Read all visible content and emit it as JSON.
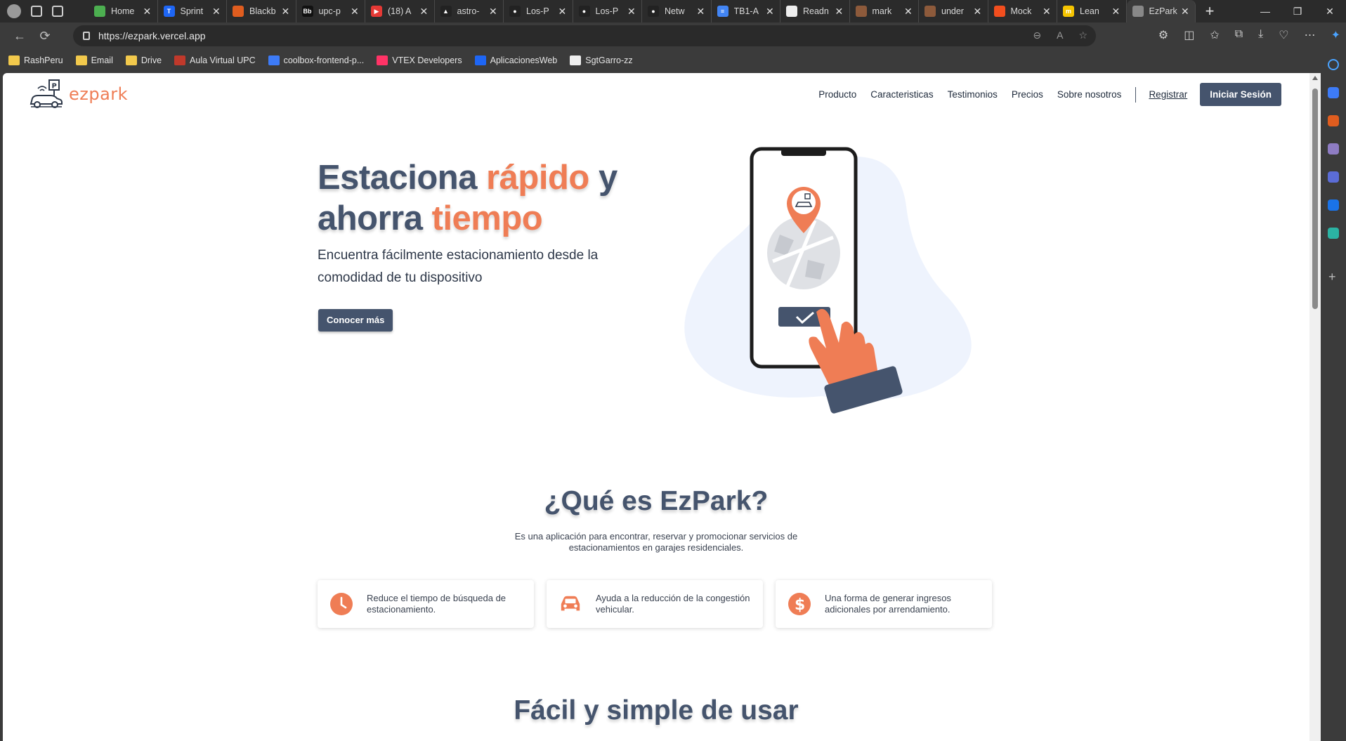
{
  "browser": {
    "tabs": [
      {
        "label": "Home",
        "favicon_color": "#4caf50",
        "favicon_text": ""
      },
      {
        "label": "Sprint",
        "favicon_color": "#1e66f5",
        "favicon_text": "T"
      },
      {
        "label": "Blackb",
        "favicon_color": "#e05d1f",
        "favicon_text": ""
      },
      {
        "label": "upc-p",
        "favicon_color": "#111111",
        "favicon_text": "Bb"
      },
      {
        "label": "(18) A",
        "favicon_color": "#e53935",
        "favicon_text": "▶"
      },
      {
        "label": "astro-",
        "favicon_color": "#222222",
        "favicon_text": "▲"
      },
      {
        "label": "Los-P",
        "favicon_color": "#222222",
        "favicon_text": "●"
      },
      {
        "label": "Los-P",
        "favicon_color": "#222222",
        "favicon_text": "●"
      },
      {
        "label": "Netw",
        "favicon_color": "#222222",
        "favicon_text": "●"
      },
      {
        "label": "TB1-A",
        "favicon_color": "#4285f4",
        "favicon_text": "≡"
      },
      {
        "label": "Readn",
        "favicon_color": "#eeeeee",
        "favicon_text": ""
      },
      {
        "label": "mark",
        "favicon_color": "#8d5a3b",
        "favicon_text": ""
      },
      {
        "label": "under",
        "favicon_color": "#8d5a3b",
        "favicon_text": ""
      },
      {
        "label": "Mock",
        "favicon_color": "#f24e1e",
        "favicon_text": ""
      },
      {
        "label": "Lean",
        "favicon_color": "#f5c400",
        "favicon_text": "m"
      },
      {
        "label": "EzPark",
        "favicon_color": "#888888",
        "favicon_text": "",
        "active": true
      }
    ],
    "url": "https://ezpark.vercel.app",
    "bookmarks": [
      {
        "label": "RashPeru",
        "color": "#f2c94c"
      },
      {
        "label": "Email",
        "color": "#f2c94c"
      },
      {
        "label": "Drive",
        "color": "#f2c94c"
      },
      {
        "label": "Aula Virtual UPC",
        "color": "#c0392b"
      },
      {
        "label": "coolbox-frontend-p...",
        "color": "#3d7bf7"
      },
      {
        "label": "VTEX Developers",
        "color": "#ff3366"
      },
      {
        "label": "AplicacionesWeb",
        "color": "#1e66f5"
      },
      {
        "label": "SgtGarro-zz",
        "color": "#eeeeee"
      }
    ]
  },
  "site": {
    "logo_text": "ezpark",
    "nav": {
      "items": [
        "Producto",
        "Caracteristicas",
        "Testimonios",
        "Precios",
        "Sobre nosotros"
      ],
      "register": "Registrar",
      "login": "Iniciar Sesión"
    },
    "hero": {
      "title_part1": "Estaciona ",
      "title_accent1": "rápido",
      "title_part2": " y ahorra ",
      "title_accent2": "tiempo",
      "subtitle": "Encuentra fácilmente estacionamiento desde la comodidad de tu dispositivo",
      "cta": "Conocer más"
    },
    "what": {
      "title": "¿Qué es EzPark?",
      "description": "Es una aplicación para encontrar, reservar y promocionar servicios de estacionamientos en garajes residenciales.",
      "features": [
        {
          "icon": "clock-icon",
          "text": "Reduce el tiempo de búsqueda de estacionamiento."
        },
        {
          "icon": "car-icon",
          "text": "Ayuda a la reducción de la congestión vehicular."
        },
        {
          "icon": "dollar-icon",
          "text": "Una forma de generar ingresos adicionales por arrendamiento."
        }
      ]
    },
    "easy": {
      "title": "Fácil y simple de usar"
    },
    "colors": {
      "primary": "#45546d",
      "accent": "#ef7d55",
      "blob": "#eef3fd"
    }
  }
}
